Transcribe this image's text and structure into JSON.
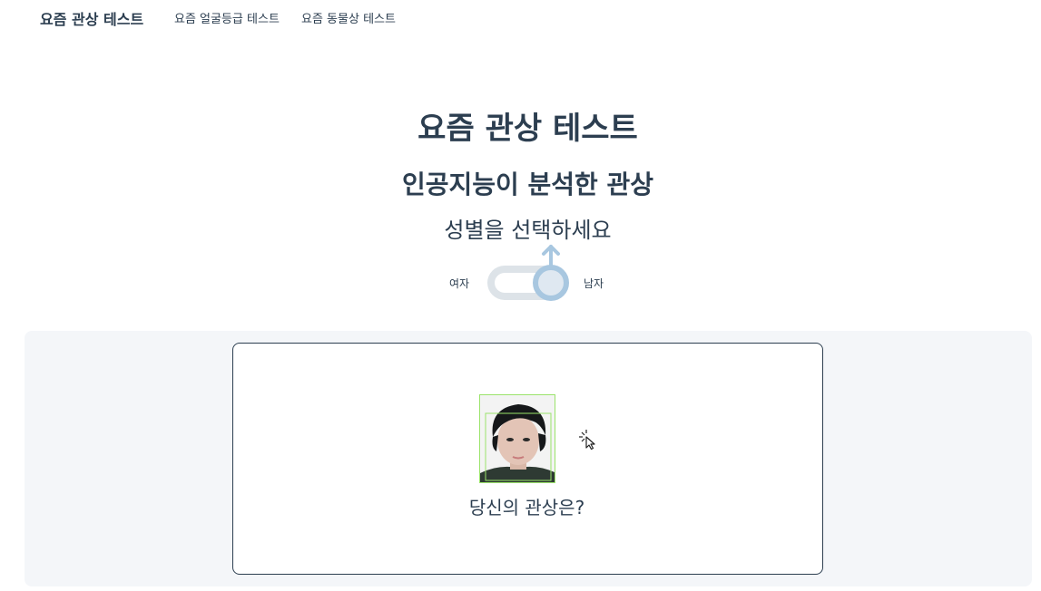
{
  "nav": {
    "brand": "요즘 관상 테스트",
    "links": [
      "요즘 얼굴등급 테스트",
      "요즘 동물상 테스트"
    ]
  },
  "main": {
    "title": "요즘 관상 테스트",
    "subtitle": "인공지능이 분석한 관상",
    "gender_prompt": "성별을 선택하세요",
    "gender_toggle": {
      "left_label": "여자",
      "right_label": "남자",
      "selected": "남자",
      "icon": "male-symbol-icon"
    },
    "upload": {
      "result_prompt": "당신의 관상은?",
      "cursor_icon": "click-cursor-icon"
    }
  },
  "colors": {
    "text": "#2c3e50",
    "toggle_accent": "#a8c7e0",
    "panel_bg": "#f4f6f9",
    "face_box": "#9be36b"
  }
}
